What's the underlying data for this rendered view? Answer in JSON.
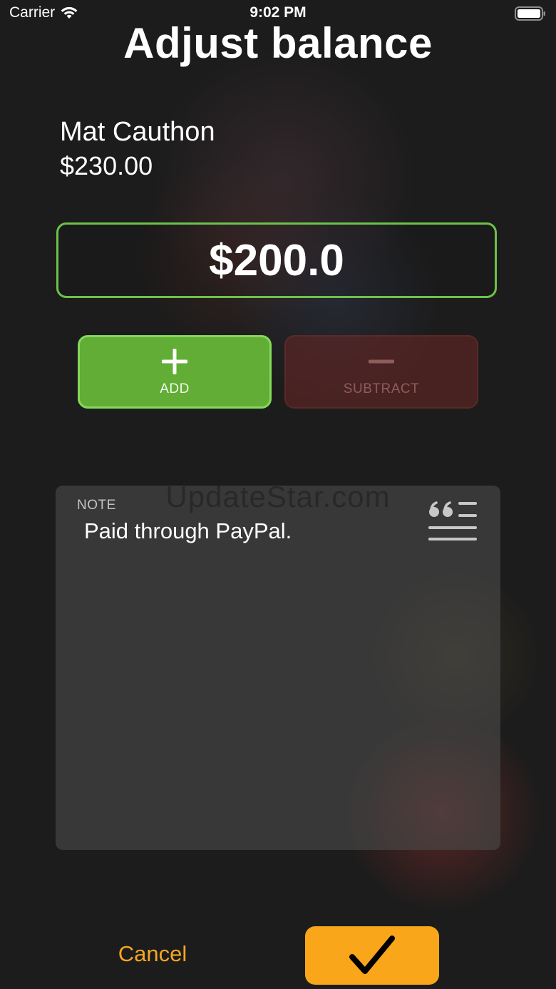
{
  "status_bar": {
    "carrier": "Carrier",
    "time": "9:02 PM"
  },
  "title": "Adjust balance",
  "user": {
    "name": "Mat Cauthon",
    "balance": "$230.00"
  },
  "amount": "$200.0",
  "operations": {
    "add_label": "ADD",
    "subtract_label": "SUBTRACT",
    "selected": "add"
  },
  "note": {
    "label": "NOTE",
    "text": "Paid through PayPal."
  },
  "watermark": "UpdateStar.com",
  "footer": {
    "cancel_label": "Cancel"
  },
  "icons": {
    "wifi": "wifi-icon",
    "battery": "battery-icon",
    "add": "plus-icon",
    "subtract": "minus-icon",
    "note": "quote-lines-icon",
    "confirm": "checkmark-icon"
  },
  "colors": {
    "accent_green": "#6cc24a",
    "add_fill": "#62ad35",
    "subtract_fill": "#6e2826",
    "confirm_orange": "#f9a61a",
    "cancel_orange": "#f5a623"
  }
}
